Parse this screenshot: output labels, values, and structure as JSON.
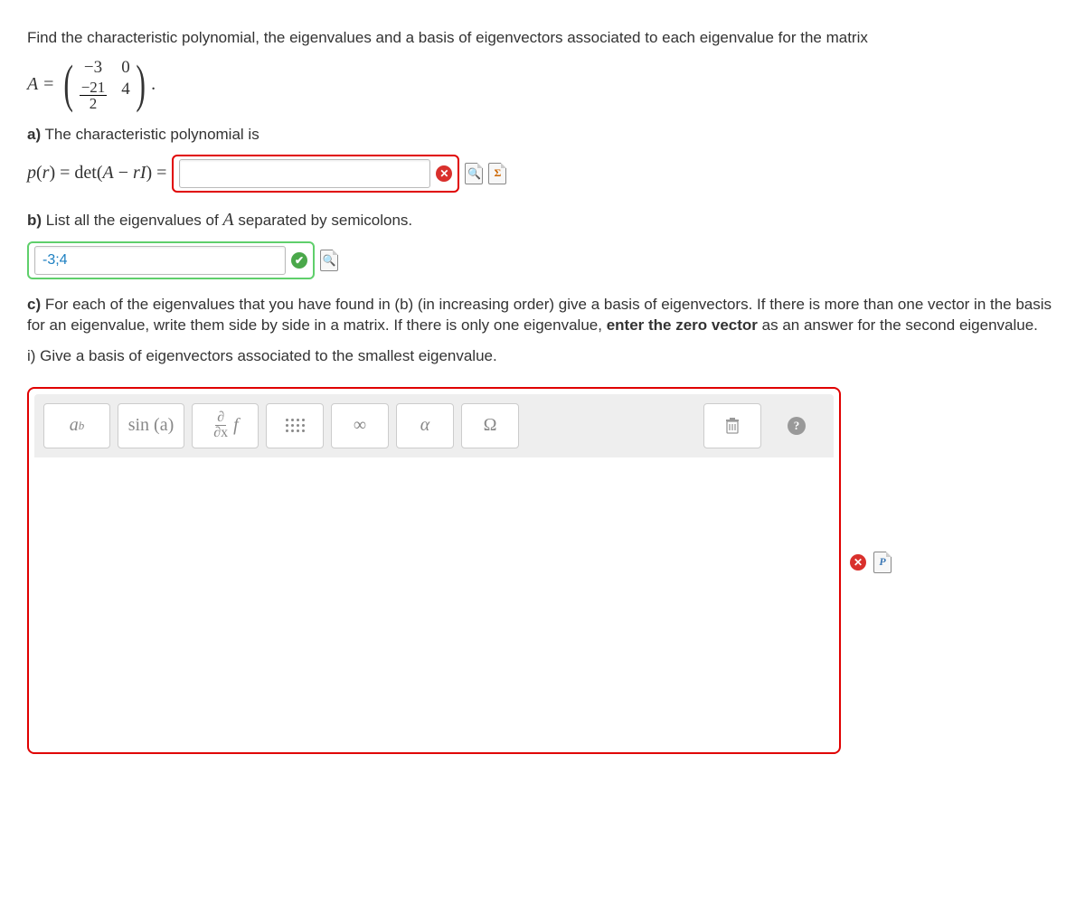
{
  "question": {
    "intro": "Find the characteristic polynomial, the eigenvalues and a basis of eigenvectors associated to each eigenvalue for the matrix",
    "matrix": {
      "lhs": "A =",
      "a11": "−3",
      "a12": "0",
      "a21_num": "−21",
      "a21_den": "2",
      "a22": "4",
      "tail": "."
    },
    "parts": {
      "a": {
        "label": "a)",
        "text": "The characteristic polynomial is",
        "expr_prefix": "p(r) = det(A − rI) =",
        "input_value": "",
        "status": "wrong"
      },
      "b": {
        "label": "b)",
        "text": "List all the eigenvalues of A separated by semicolons.",
        "input_value": "-3;4",
        "status": "correct"
      },
      "c": {
        "label": "c)",
        "text_before": "For each of the eigenvalues that you have found in (b) (in increasing order) give a basis of eigenvectors. If there is more than one vector in the basis for an eigenvalue, write them side by side in a matrix. If there is only one eigenvalue, ",
        "bold_text": "enter the zero vector",
        "text_after": " as an answer for the second eigenvalue.",
        "sub_i": "i) Give a basis of eigenvectors associated to the smallest eigenvalue."
      }
    }
  },
  "toolbar": {
    "btn_power_base": "a",
    "btn_power_sup": "b",
    "btn_sin": "sin (a)",
    "btn_partial_top": "∂",
    "btn_partial_bot": "∂x",
    "btn_partial_f": "f",
    "btn_infinity": "∞",
    "btn_alpha": "α",
    "btn_omega": "Ω"
  }
}
